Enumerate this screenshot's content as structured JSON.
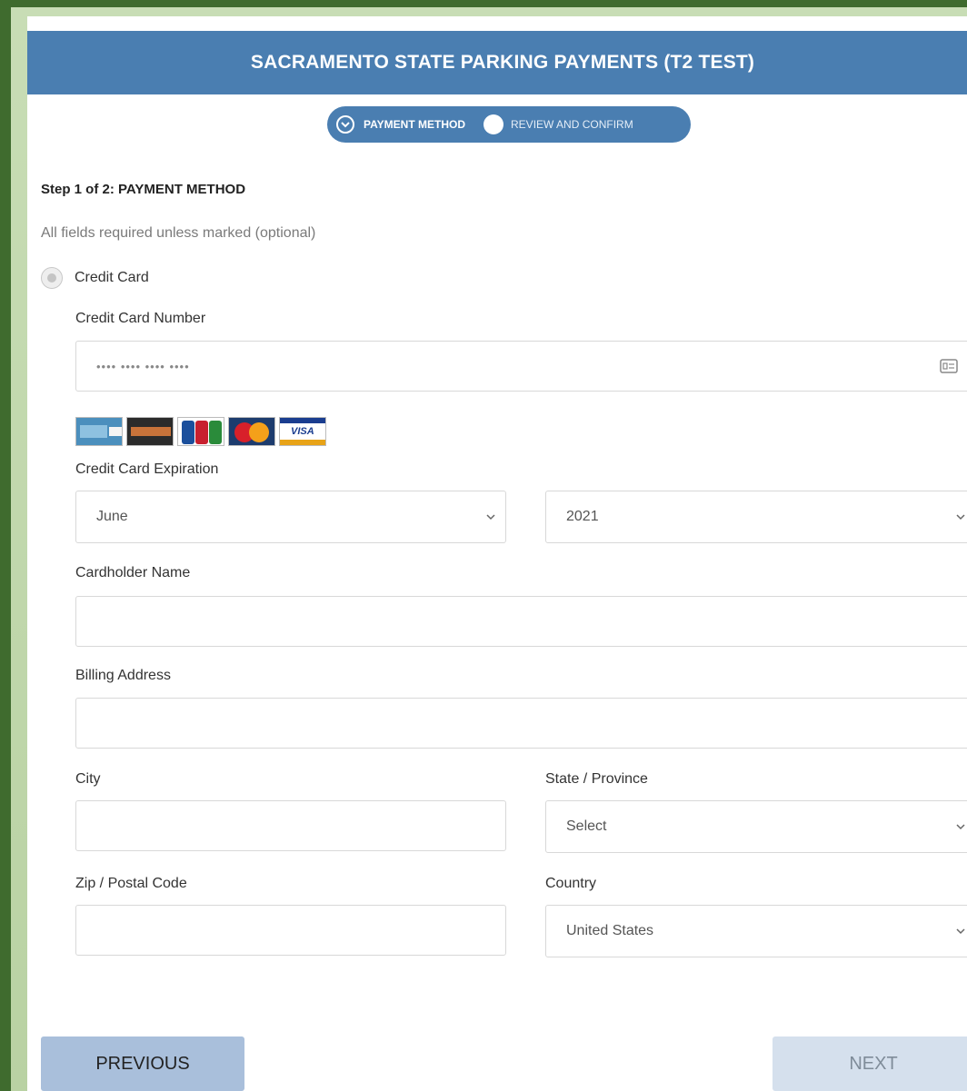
{
  "header": {
    "title": "SACRAMENTO STATE PARKING PAYMENTS (T2 TEST)"
  },
  "stepper": {
    "step1_label": "PAYMENT METHOD",
    "step2_label": "REVIEW AND CONFIRM",
    "step1_icon": "chevron-circle-icon"
  },
  "form": {
    "step_title": "Step 1 of 2: PAYMENT METHOD",
    "required_note": "All fields required unless marked (optional)",
    "payment_option": "Credit Card",
    "card_number_label": "Credit Card Number",
    "card_number_placeholder": "•••• •••• •••• ••••",
    "card_logos": [
      "American Express",
      "Discover",
      "JCB",
      "MasterCard",
      "VISA"
    ],
    "expiration_label": "Credit Card Expiration",
    "expiration_month": "June",
    "expiration_year": "2021",
    "cardholder_label": "Cardholder Name",
    "billing_label": "Billing Address",
    "city_label": "City",
    "state_label": "State / Province",
    "state_value": "Select",
    "zip_label": "Zip / Postal Code",
    "country_label": "Country",
    "country_value": "United States"
  },
  "buttons": {
    "previous": "PREVIOUS",
    "next": "NEXT"
  },
  "colors": {
    "header": "#4a7eb1",
    "frame": "#3f6b2e",
    "previous": "#a9bfdb",
    "next": "#d5e0ed"
  }
}
